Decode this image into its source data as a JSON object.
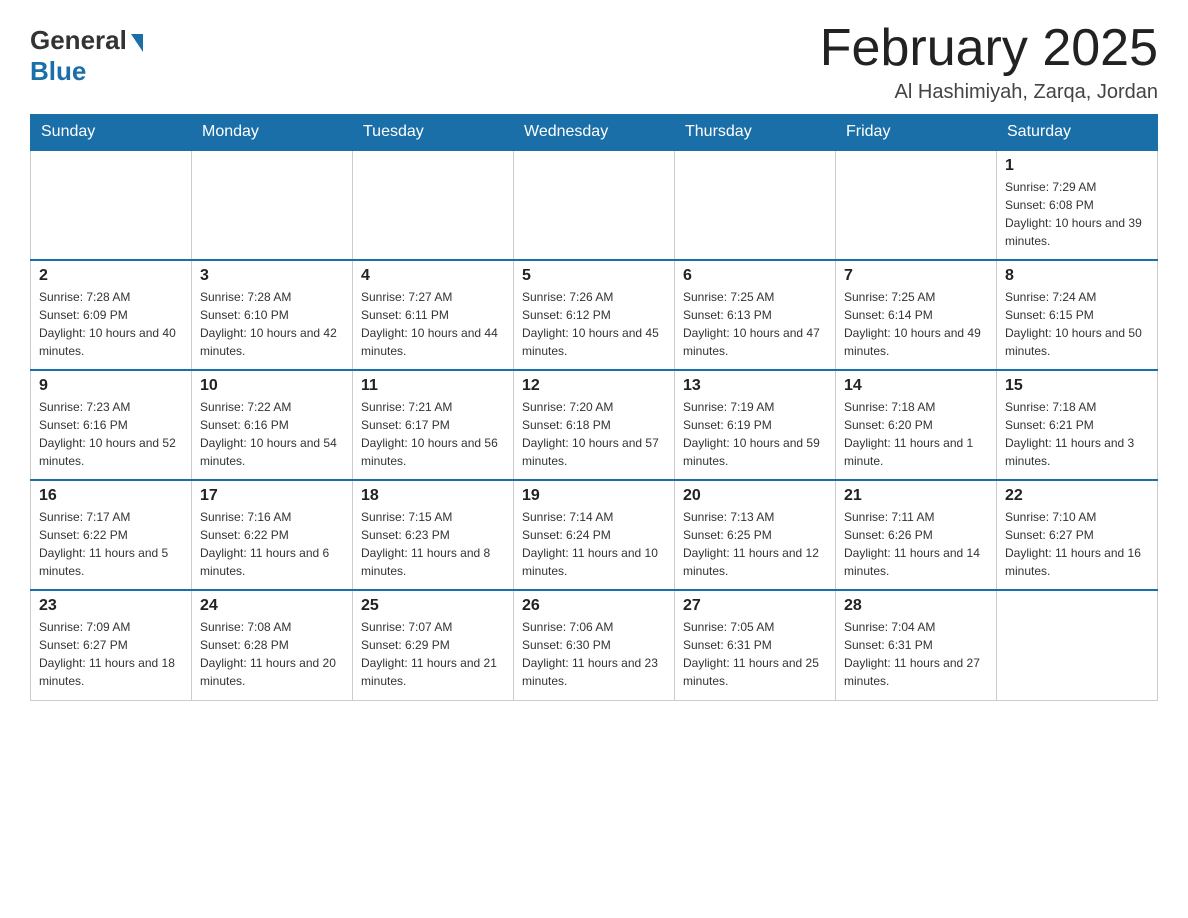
{
  "header": {
    "logo_general": "General",
    "logo_blue": "Blue",
    "month_title": "February 2025",
    "location": "Al Hashimiyah, Zarqa, Jordan"
  },
  "days_of_week": [
    "Sunday",
    "Monday",
    "Tuesday",
    "Wednesday",
    "Thursday",
    "Friday",
    "Saturday"
  ],
  "weeks": [
    [
      {
        "day": "",
        "info": ""
      },
      {
        "day": "",
        "info": ""
      },
      {
        "day": "",
        "info": ""
      },
      {
        "day": "",
        "info": ""
      },
      {
        "day": "",
        "info": ""
      },
      {
        "day": "",
        "info": ""
      },
      {
        "day": "1",
        "info": "Sunrise: 7:29 AM\nSunset: 6:08 PM\nDaylight: 10 hours and 39 minutes."
      }
    ],
    [
      {
        "day": "2",
        "info": "Sunrise: 7:28 AM\nSunset: 6:09 PM\nDaylight: 10 hours and 40 minutes."
      },
      {
        "day": "3",
        "info": "Sunrise: 7:28 AM\nSunset: 6:10 PM\nDaylight: 10 hours and 42 minutes."
      },
      {
        "day": "4",
        "info": "Sunrise: 7:27 AM\nSunset: 6:11 PM\nDaylight: 10 hours and 44 minutes."
      },
      {
        "day": "5",
        "info": "Sunrise: 7:26 AM\nSunset: 6:12 PM\nDaylight: 10 hours and 45 minutes."
      },
      {
        "day": "6",
        "info": "Sunrise: 7:25 AM\nSunset: 6:13 PM\nDaylight: 10 hours and 47 minutes."
      },
      {
        "day": "7",
        "info": "Sunrise: 7:25 AM\nSunset: 6:14 PM\nDaylight: 10 hours and 49 minutes."
      },
      {
        "day": "8",
        "info": "Sunrise: 7:24 AM\nSunset: 6:15 PM\nDaylight: 10 hours and 50 minutes."
      }
    ],
    [
      {
        "day": "9",
        "info": "Sunrise: 7:23 AM\nSunset: 6:16 PM\nDaylight: 10 hours and 52 minutes."
      },
      {
        "day": "10",
        "info": "Sunrise: 7:22 AM\nSunset: 6:16 PM\nDaylight: 10 hours and 54 minutes."
      },
      {
        "day": "11",
        "info": "Sunrise: 7:21 AM\nSunset: 6:17 PM\nDaylight: 10 hours and 56 minutes."
      },
      {
        "day": "12",
        "info": "Sunrise: 7:20 AM\nSunset: 6:18 PM\nDaylight: 10 hours and 57 minutes."
      },
      {
        "day": "13",
        "info": "Sunrise: 7:19 AM\nSunset: 6:19 PM\nDaylight: 10 hours and 59 minutes."
      },
      {
        "day": "14",
        "info": "Sunrise: 7:18 AM\nSunset: 6:20 PM\nDaylight: 11 hours and 1 minute."
      },
      {
        "day": "15",
        "info": "Sunrise: 7:18 AM\nSunset: 6:21 PM\nDaylight: 11 hours and 3 minutes."
      }
    ],
    [
      {
        "day": "16",
        "info": "Sunrise: 7:17 AM\nSunset: 6:22 PM\nDaylight: 11 hours and 5 minutes."
      },
      {
        "day": "17",
        "info": "Sunrise: 7:16 AM\nSunset: 6:22 PM\nDaylight: 11 hours and 6 minutes."
      },
      {
        "day": "18",
        "info": "Sunrise: 7:15 AM\nSunset: 6:23 PM\nDaylight: 11 hours and 8 minutes."
      },
      {
        "day": "19",
        "info": "Sunrise: 7:14 AM\nSunset: 6:24 PM\nDaylight: 11 hours and 10 minutes."
      },
      {
        "day": "20",
        "info": "Sunrise: 7:13 AM\nSunset: 6:25 PM\nDaylight: 11 hours and 12 minutes."
      },
      {
        "day": "21",
        "info": "Sunrise: 7:11 AM\nSunset: 6:26 PM\nDaylight: 11 hours and 14 minutes."
      },
      {
        "day": "22",
        "info": "Sunrise: 7:10 AM\nSunset: 6:27 PM\nDaylight: 11 hours and 16 minutes."
      }
    ],
    [
      {
        "day": "23",
        "info": "Sunrise: 7:09 AM\nSunset: 6:27 PM\nDaylight: 11 hours and 18 minutes."
      },
      {
        "day": "24",
        "info": "Sunrise: 7:08 AM\nSunset: 6:28 PM\nDaylight: 11 hours and 20 minutes."
      },
      {
        "day": "25",
        "info": "Sunrise: 7:07 AM\nSunset: 6:29 PM\nDaylight: 11 hours and 21 minutes."
      },
      {
        "day": "26",
        "info": "Sunrise: 7:06 AM\nSunset: 6:30 PM\nDaylight: 11 hours and 23 minutes."
      },
      {
        "day": "27",
        "info": "Sunrise: 7:05 AM\nSunset: 6:31 PM\nDaylight: 11 hours and 25 minutes."
      },
      {
        "day": "28",
        "info": "Sunrise: 7:04 AM\nSunset: 6:31 PM\nDaylight: 11 hours and 27 minutes."
      },
      {
        "day": "",
        "info": ""
      }
    ]
  ]
}
